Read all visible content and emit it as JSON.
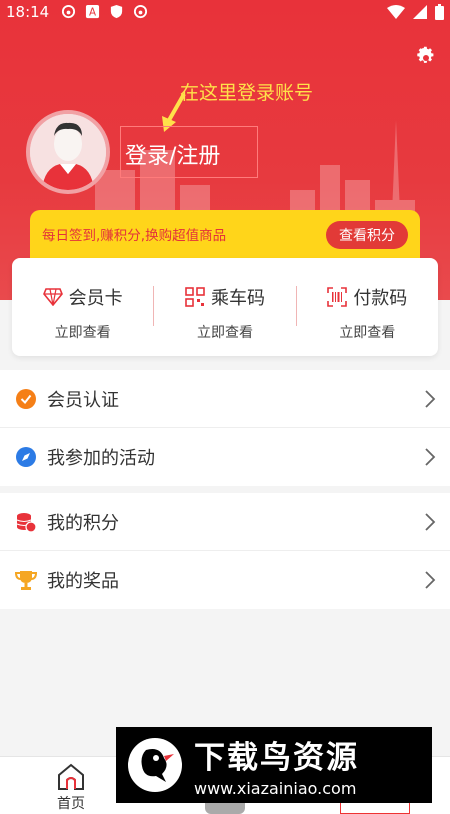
{
  "status_bar": {
    "time": "18:14",
    "notification_icons": [
      "netease-music-icon",
      "a-app-icon",
      "shield-icon",
      "netease-music-icon"
    ],
    "right_icons": [
      "wifi-icon",
      "signal-icon",
      "battery-icon"
    ]
  },
  "profile": {
    "login_text": "登录/注册",
    "hint_text": "在这里登录账号",
    "settings_icon": "gear-icon"
  },
  "points_banner": {
    "text": "每日签到,赚积分,换购超值商品",
    "button_label": "查看积分"
  },
  "quick_cards": [
    {
      "icon": "diamond-icon",
      "title": "会员卡",
      "sub": "立即查看"
    },
    {
      "icon": "qr-code-icon",
      "title": "乘车码",
      "sub": "立即查看"
    },
    {
      "icon": "barcode-icon",
      "title": "付款码",
      "sub": "立即查看"
    }
  ],
  "menu_group_1": [
    {
      "icon": "verified-icon",
      "label": "会员认证"
    },
    {
      "icon": "compass-icon",
      "label": "我参加的活动"
    }
  ],
  "menu_group_2": [
    {
      "icon": "coins-icon",
      "label": "我的积分"
    },
    {
      "icon": "trophy-icon",
      "label": "我的奖品"
    }
  ],
  "bottom_nav": {
    "home_label": "首页"
  },
  "watermark": {
    "title": "下载鸟资源",
    "url": "www.xiazainiao.com"
  },
  "colors": {
    "header_red": "#e8323a",
    "banner_yellow": "#ffd51a",
    "hint_yellow": "#ffe14a"
  }
}
